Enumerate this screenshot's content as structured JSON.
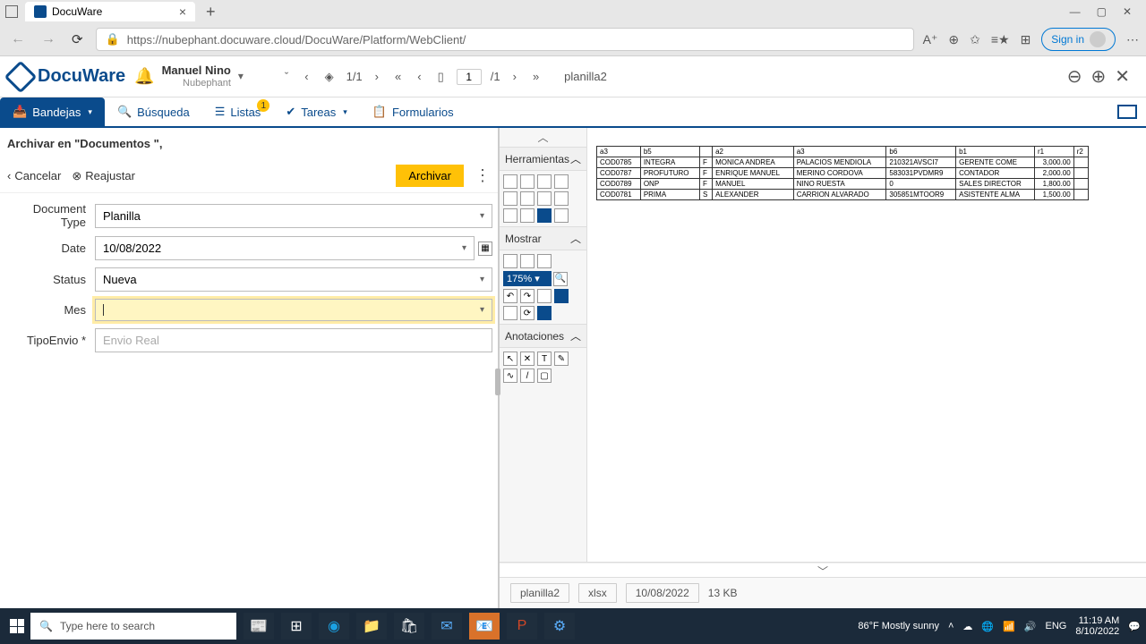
{
  "browser": {
    "tab_title": "DocuWare",
    "url": "https://nubephant.docuware.cloud/DocuWare/Platform/WebClient/",
    "signin": "Sign in"
  },
  "app": {
    "logo": "DocuWare",
    "user_name": "Manuel Nino",
    "user_org": "Nubephant"
  },
  "viewer": {
    "page_display": "1/1",
    "page_input": "1",
    "page_total": "/1",
    "doc_name": "planilla2"
  },
  "nav": {
    "bandejas": "Bandejas",
    "busqueda": "Búsqueda",
    "listas": "Listas",
    "listas_badge": "1",
    "tareas": "Tareas",
    "formularios": "Formularios"
  },
  "form": {
    "title": "Archivar en \"Documentos \",",
    "cancel": "Cancelar",
    "reset": "Reajustar",
    "archive": "Archivar",
    "labels": {
      "doctype": "Document Type",
      "date": "Date",
      "status": "Status",
      "mes": "Mes",
      "tipoenvio": "TipoEnvio *"
    },
    "values": {
      "doctype": "Planilla",
      "date": "10/08/2022",
      "status": "Nueva",
      "mes": "",
      "tipoenvio_placeholder": "Envio Real"
    }
  },
  "tools": {
    "herramientas": "Herramientas",
    "mostrar": "Mostrar",
    "zoom": "175%",
    "anotaciones": "Anotaciones"
  },
  "doc_footer": {
    "name": "planilla2",
    "ext": "xlsx",
    "date": "10/08/2022",
    "size": "13 KB"
  },
  "taskbar": {
    "search_placeholder": "Type here to search",
    "weather": "86°F Mostly sunny",
    "lang": "ENG",
    "time": "11:19 AM",
    "date": "8/10/2022"
  },
  "chart_data": {
    "type": "table",
    "headers": [
      "a3",
      "b5",
      "",
      "a2",
      "a3",
      "b6",
      "b1",
      "r1",
      "r2"
    ],
    "rows": [
      [
        "COD0785",
        "INTEGRA",
        "F",
        "MONICA ANDREA",
        "PALACIOS MENDIOLA",
        "210321AVSCI7",
        "GERENTE COME",
        "3,000.00",
        ""
      ],
      [
        "COD0787",
        "PROFUTURO",
        "F",
        "ENRIQUE MANUEL",
        "MERINO CORDOVA",
        "583031PVDMR9",
        "CONTADOR",
        "2,000.00",
        ""
      ],
      [
        "COD0789",
        "ONP",
        "F",
        "MANUEL",
        "NINO RUESTA",
        "0",
        "SALES DIRECTOR",
        "1,800.00",
        ""
      ],
      [
        "COD0781",
        "PRIMA",
        "S",
        "ALEXANDER",
        "CARRION ALVARADO",
        "305851MTOOR9",
        "ASISTENTE ALMA",
        "1,500.00",
        ""
      ]
    ]
  }
}
